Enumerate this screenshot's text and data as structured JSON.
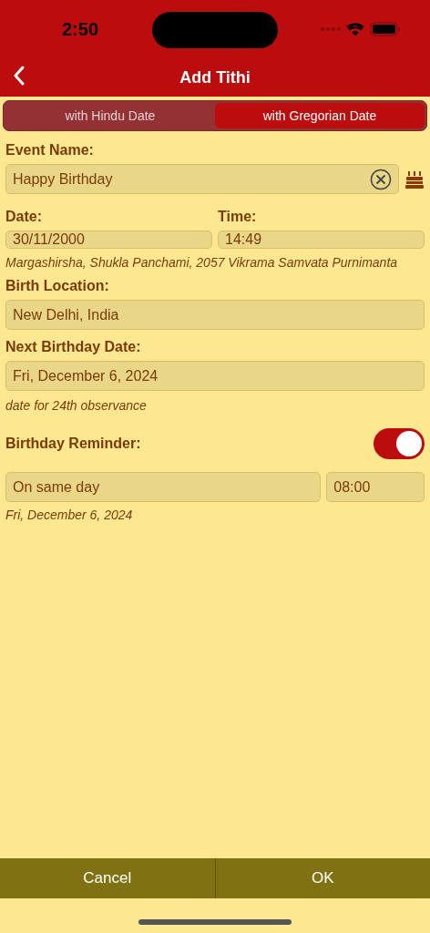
{
  "status_bar": {
    "time": "2:50"
  },
  "nav": {
    "title": "Add Tithi"
  },
  "tabs": [
    {
      "label": "with Hindu Date",
      "selected": false
    },
    {
      "label": "with Gregorian Date",
      "selected": true
    }
  ],
  "event_name": {
    "label": "Event Name:",
    "value": "Happy Birthday"
  },
  "date": {
    "label": "Date:",
    "value": "30/11/2000"
  },
  "time": {
    "label": "Time:",
    "value": "14:49"
  },
  "hindu_date_note": "Margashirsha, Shukla Panchami, 2057 Vikrama Samvata Purnimanta",
  "birth_location": {
    "label": "Birth Location:",
    "value": "New Delhi, India"
  },
  "next_birthday": {
    "label": "Next Birthday Date:",
    "value": "Fri, December 6, 2024",
    "note": "date for 24th observance"
  },
  "reminder": {
    "label": "Birthday Reminder:",
    "on": true,
    "when": "On same day",
    "time": "08:00",
    "note": "Fri, December 6, 2024"
  },
  "buttons": [
    "Cancel",
    "OK"
  ]
}
